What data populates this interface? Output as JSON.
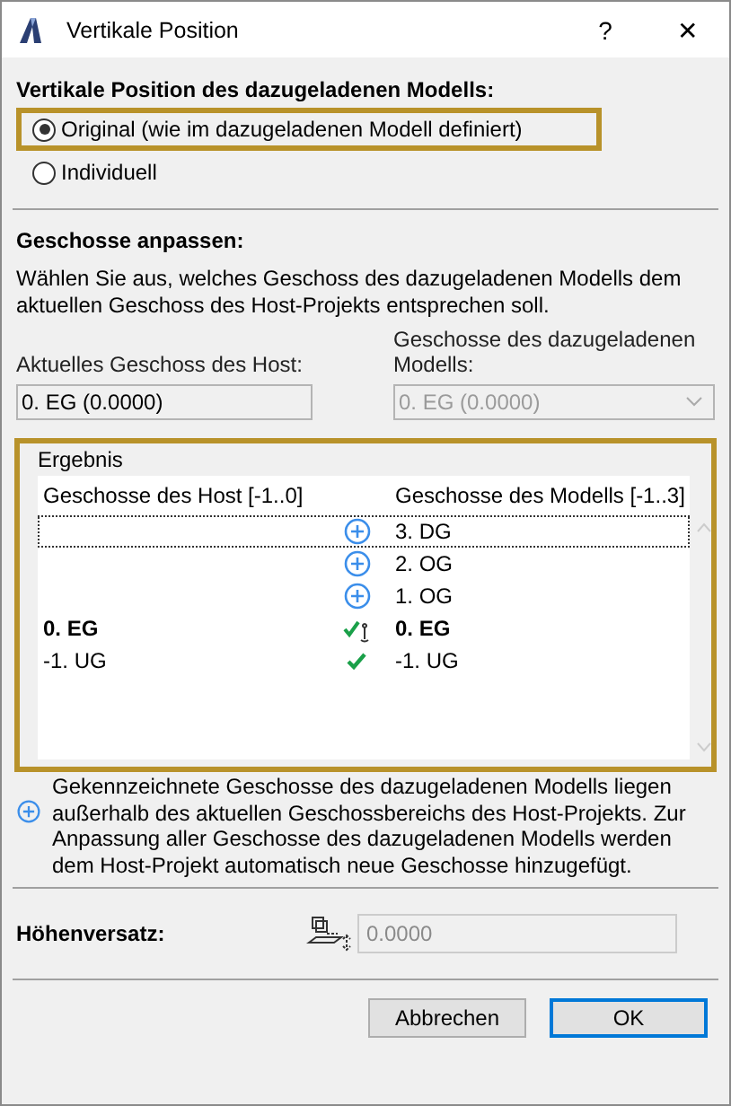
{
  "window": {
    "title": "Vertikale Position",
    "help": "?",
    "close": "✕"
  },
  "position": {
    "heading": "Vertikale Position des dazugeladenen Modells:",
    "options": [
      {
        "label": "Original (wie im dazugeladenen Modell definiert)",
        "selected": true,
        "highlighted": true
      },
      {
        "label": "Individuell",
        "selected": false,
        "highlighted": false
      }
    ]
  },
  "stories": {
    "heading": "Geschosse anpassen:",
    "description": "Wählen Sie aus, welches Geschoss des dazugeladenen Modells dem aktuellen Geschoss des Host-Projekts entsprechen soll.",
    "host_label": "Aktuelles Geschoss des Host:",
    "host_value": "0. EG (0.0000)",
    "model_label": "Geschosse des dazugeladenen Modells:",
    "model_value": "0. EG (0.0000)",
    "model_disabled": true
  },
  "result": {
    "title": "Ergebnis",
    "highlighted": true,
    "columns": [
      "Geschosse des Host [-1..0]",
      "Geschosse des Modells [-1..3]"
    ],
    "rows": [
      {
        "host": "",
        "kind": "add",
        "model": "3. DG",
        "bold": false,
        "focused": true
      },
      {
        "host": "",
        "kind": "add",
        "model": "2. OG",
        "bold": false,
        "focused": false
      },
      {
        "host": "",
        "kind": "add",
        "model": "1. OG",
        "bold": false,
        "focused": false
      },
      {
        "host": "0. EG",
        "kind": "anchor",
        "model": "0. EG",
        "bold": true,
        "focused": false
      },
      {
        "host": "-1. UG",
        "kind": "match",
        "model": "-1. UG",
        "bold": false,
        "focused": false
      }
    ]
  },
  "note": "Gekennzeichnete Geschosse des dazugeladenen Modells liegen außerhalb des aktuellen Geschossbereichs des Host-Projekts. Zur Anpassung aller Geschosse des dazugeladenen Modells werden dem Host-Projekt automatisch neue Geschosse hinzugefügt.",
  "offset": {
    "label": "Höhenversatz:",
    "value": "0.0000",
    "disabled": true
  },
  "buttons": [
    {
      "label": "Abbrechen",
      "default": false
    },
    {
      "label": "OK",
      "default": true
    }
  ]
}
